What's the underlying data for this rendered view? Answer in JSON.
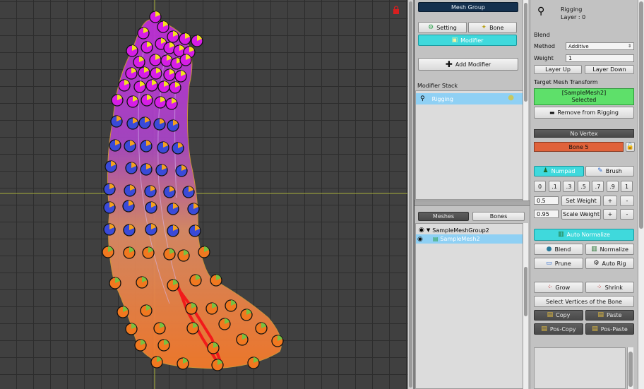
{
  "mesh_group": {
    "header": "Mesh Group",
    "setting_label": "Setting",
    "bone_label": "Bone",
    "modifier_label": "Modifier",
    "add_modifier_label": "Add Modifier",
    "modifier_stack_label": "Modifier Stack",
    "modifiers": [
      {
        "label": "Rigging"
      }
    ]
  },
  "hierarchy": {
    "tabs": [
      {
        "label": "Meshes"
      },
      {
        "label": "Bones"
      }
    ],
    "group_label": "SampleMeshGroup2",
    "mesh_label": "SampleMesh2"
  },
  "rigging": {
    "title": "Rigging",
    "layer": "Layer : 0",
    "blend_heading": "Blend",
    "method_label": "Method",
    "method_value": "Additive",
    "weight_label": "Weight",
    "weight_value": "1",
    "layer_up": "Layer Up",
    "layer_down": "Layer Down",
    "target_heading": "Target Mesh Transform",
    "target_name": "[SampleMesh2]",
    "target_state": "Selected",
    "remove_label": "Remove from Rigging",
    "vertex_status": "No Vertex",
    "bone_name": "Bone 5",
    "numpad_label": "Numpad",
    "brush_label": "Brush",
    "presets": [
      "0",
      ".1",
      ".3",
      ".5",
      ".7",
      ".9",
      "1"
    ],
    "set_weight_value": "0.5",
    "set_weight_label": "Set Weight",
    "scale_weight_value": "0.95",
    "scale_weight_label": "Scale Weight",
    "plus": "+",
    "minus": "-",
    "auto_normalize_label": "Auto Normalize",
    "blend_btn": "Blend",
    "normalize_btn": "Normalize",
    "prune_btn": "Prune",
    "auto_rig_btn": "Auto Rig",
    "grow_btn": "Grow",
    "shrink_btn": "Shrink",
    "select_vertices_label": "Select Vertices of the Bone",
    "copy_btn": "Copy",
    "paste_btn": "Paste",
    "pos_copy_btn": "Pos-Copy",
    "pos_paste_btn": "Pos-Paste"
  },
  "colors": {
    "accent_cyan": "#3fd9dc",
    "bone_orange": "#e0623a",
    "target_green": "#5ee06a",
    "header_navy": "#14304e",
    "mesh_top": "#c02ed8",
    "mesh_bottom": "#f07a2c"
  },
  "icons": {
    "rigging": "bone-chain-icon",
    "lock": "lock-icon",
    "visibility": "eye-icon"
  }
}
